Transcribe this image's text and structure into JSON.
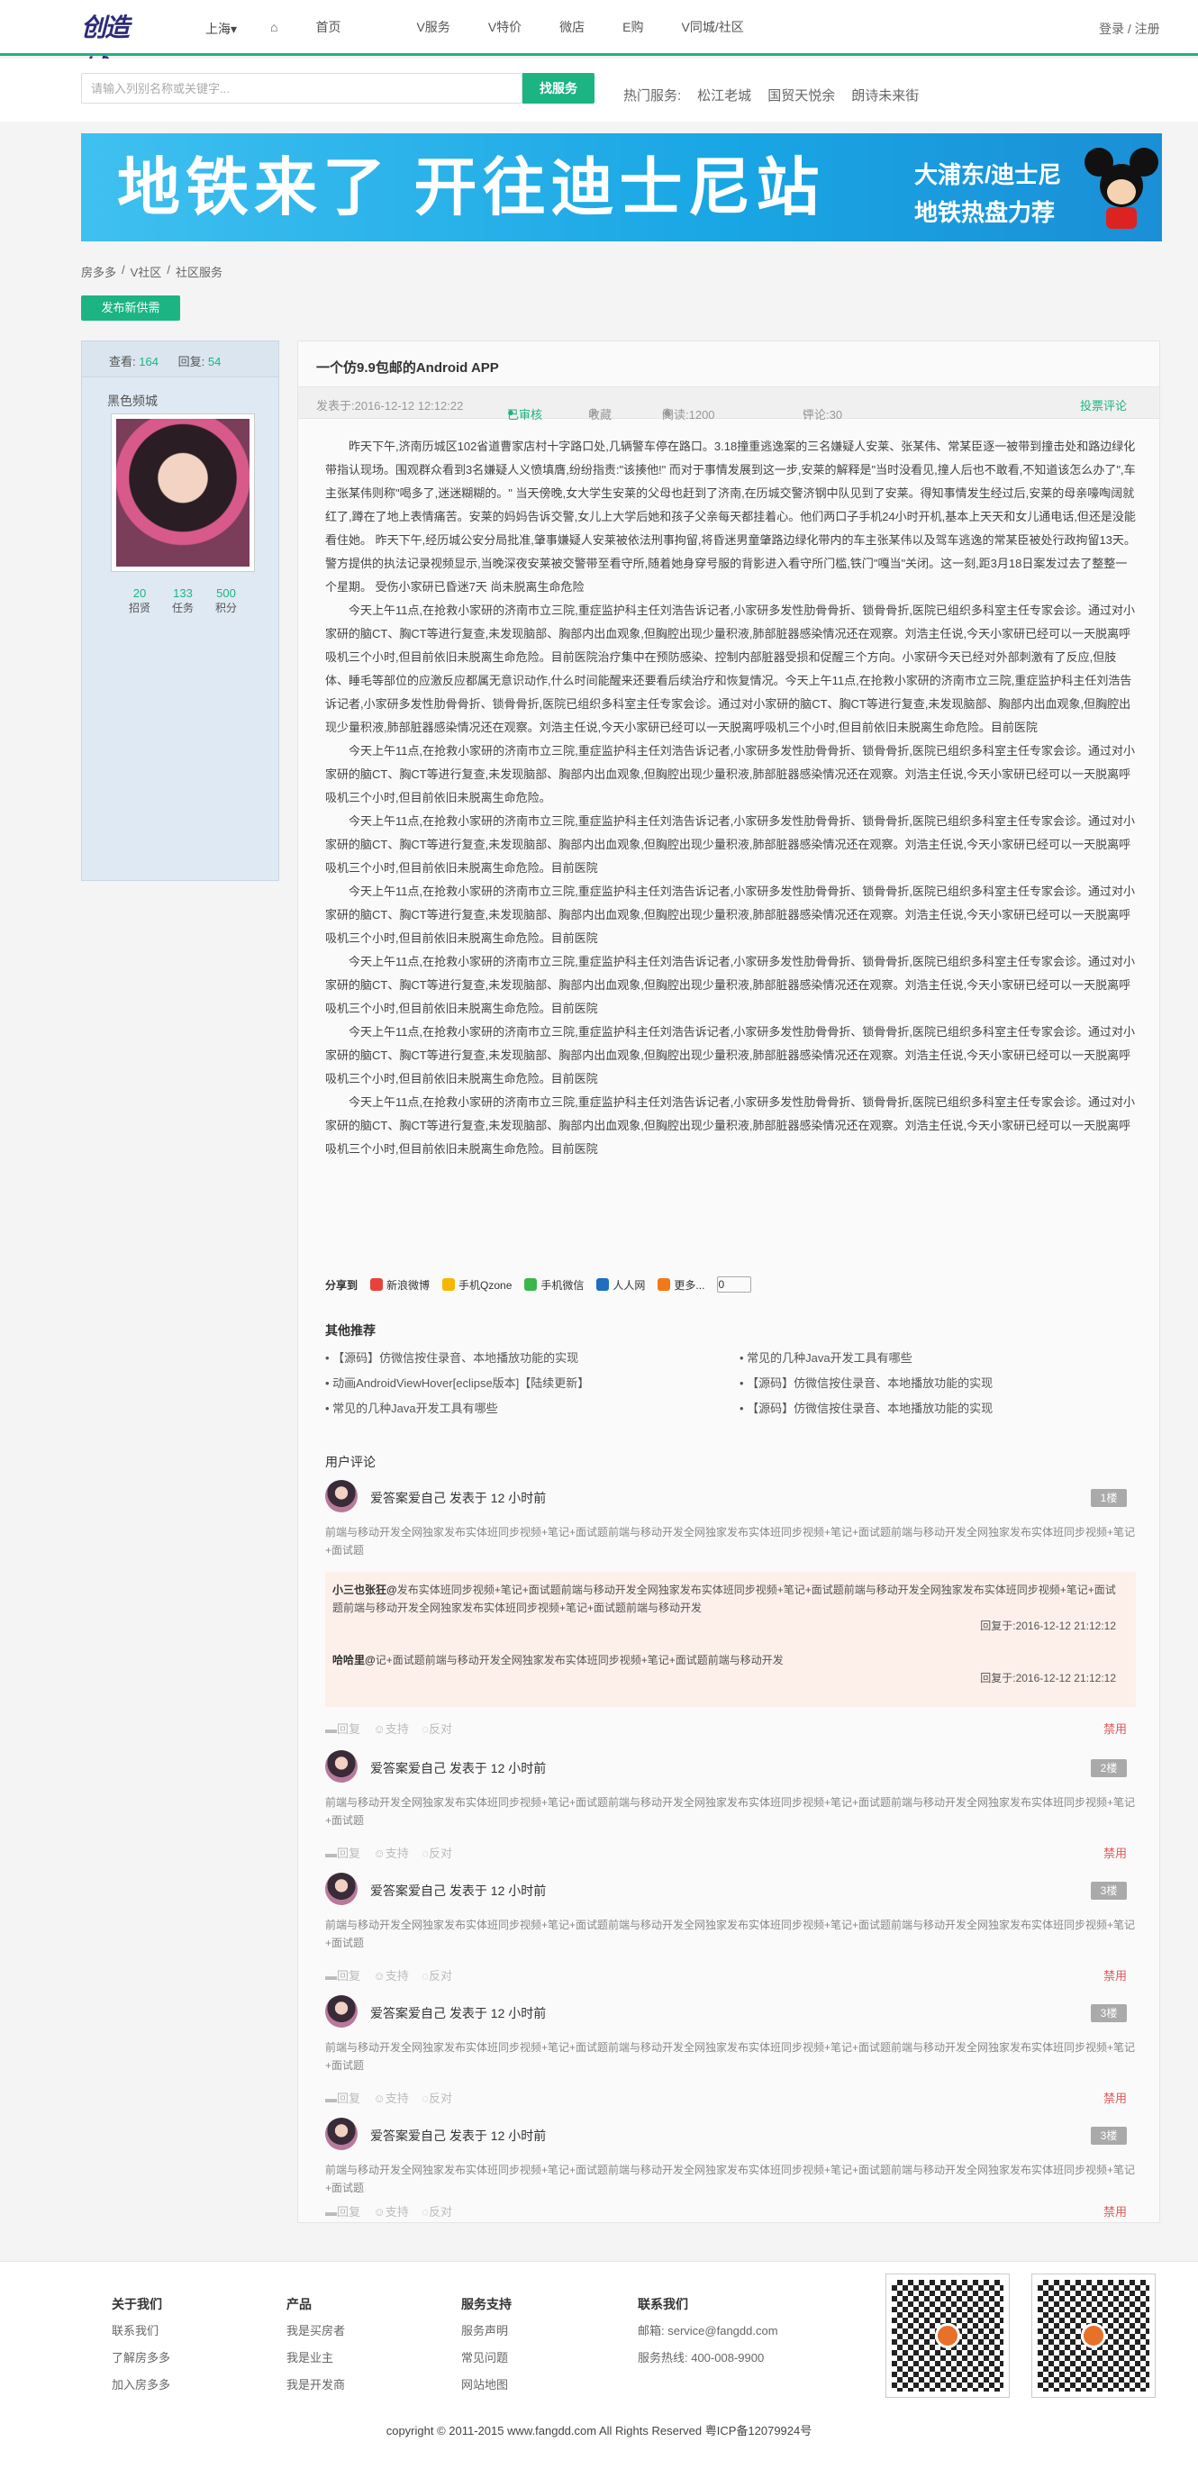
{
  "header": {
    "logo": "创造城",
    "city": "上海",
    "nav": [
      "首页",
      "V服务",
      "V特价",
      "微店",
      "E购",
      "V同城/社区"
    ],
    "login": "登录 / 注册"
  },
  "search": {
    "placeholder": "请输入列别名称或关键字...",
    "button": "找服务",
    "hot": [
      "热门服务:",
      "松江老城",
      "国贸天悦余",
      "朗诗未来街"
    ]
  },
  "banner": {
    "main": "地铁来了 开往迪士尼站",
    "side1": "大浦东/迪士尼",
    "side2": "地铁热盘力荐"
  },
  "breadcrumb": [
    "房多多",
    "/",
    "V社区",
    "/",
    "社区服务"
  ],
  "publish_label": "发布新供需",
  "sidebar": {
    "views_label": "查看:",
    "views": "164",
    "replies_label": "回复:",
    "replies": "54",
    "username": "黑色频城",
    "stats": [
      {
        "n": "20",
        "l": "招贤"
      },
      {
        "n": "133",
        "l": "任务"
      },
      {
        "n": "500",
        "l": "积分"
      }
    ]
  },
  "post": {
    "title": "一个仿9.9包邮的Android APP",
    "published": "发表于:2016-12-12 12:12:22",
    "status": "已审核",
    "collect": "收藏",
    "reads": "阅读:1200",
    "comments": "评论:30",
    "report": "投票评论",
    "paragraphs": [
      "昨天下午,济南历城区102省道曹家店村十字路口处,几辆警车停在路口。3.18撞重逃逸案的三名嫌疑人安莱、张某伟、常某臣逐一被带到撞击处和路边绿化带指认现场。围观群众看到3名嫌疑人义愤填膺,纷纷指责:\"该揍他!\" 而对于事情发展到这一步,安莱的解释是\"当时没看见,撞人后也不敢看,不知道该怎么办了\",车主张某伟则称\"喝多了,迷迷糊糊的。\"  当天傍晚,女大学生安莱的父母也赶到了济南,在历城交警济钢中队见到了安莱。得知事情发生经过后,安莱的母亲嚎啕阔就红了,蹲在了地上表情痛苦。安莱的妈妈告诉交警,女儿上大学后她和孩子父亲每天都挂着心。他们两口子手机24小时开机,基本上天天和女儿通电话,但还是没能看住她。  昨天下午,经历城公安分局批准,肇事嫌疑人安莱被依法刑事拘留,将昏迷男童肇路边绿化带内的车主张某伟以及驾车逃逸的常某臣被处行政拘留13天。警方提供的执法记录视频显示,当晚深夜安莱被交警带至看守所,随着她身穿号服的背影进入看守所门槛,铁门\"嘎当\"关闭。这一刻,距3月18日案发过去了整整一个星期。  受伤小家研已昏迷7天 尚未脱离生命危险",
      "今天上午11点,在抢救小家研的济南市立三院,重症监护科主任刘浩告诉记者,小家研多发性肋骨骨折、锁骨骨折,医院已组织多科室主任专家会诊。通过对小家研的脑CT、胸CT等进行复查,未发现脑部、胸部内出血观象,但胸腔出现少量积液,肺部脏器感染情况还在观察。刘浩主任说,今天小家研已经可以一天脱离呼吸机三个小时,但目前依旧未脱离生命危险。目前医院治疗集中在预防感染、控制内部脏器受损和促醒三个方向。小家研今天已经对外部刺激有了反应,但肢体、睡毛等部位的应激反应都属无意识动作,什么时间能醒来还要看后续治疗和恢复情况。今天上午11点,在抢救小家研的济南市立三院,重症监护科主任刘浩告诉记者,小家研多发性肋骨骨折、锁骨骨折,医院已组织多科室主任专家会诊。通过对小家研的脑CT、胸CT等进行复查,未发现脑部、胸部内出血观象,但胸腔出现少量积液,肺部脏器感染情况还在观察。刘浩主任说,今天小家研已经可以一天脱离呼吸机三个小时,但目前依旧未脱离生命危险。目前医院",
      "今天上午11点,在抢救小家研的济南市立三院,重症监护科主任刘浩告诉记者,小家研多发性肋骨骨折、锁骨骨折,医院已组织多科室主任专家会诊。通过对小家研的脑CT、胸CT等进行复查,未发现脑部、胸部内出血观象,但胸腔出现少量积液,肺部脏器感染情况还在观察。刘浩主任说,今天小家研已经可以一天脱离呼吸机三个小时,但目前依旧未脱离生命危险。",
      "今天上午11点,在抢救小家研的济南市立三院,重症监护科主任刘浩告诉记者,小家研多发性肋骨骨折、锁骨骨折,医院已组织多科室主任专家会诊。通过对小家研的脑CT、胸CT等进行复查,未发现脑部、胸部内出血观象,但胸腔出现少量积液,肺部脏器感染情况还在观察。刘浩主任说,今天小家研已经可以一天脱离呼吸机三个小时,但目前依旧未脱离生命危险。目前医院",
      "今天上午11点,在抢救小家研的济南市立三院,重症监护科主任刘浩告诉记者,小家研多发性肋骨骨折、锁骨骨折,医院已组织多科室主任专家会诊。通过对小家研的脑CT、胸CT等进行复查,未发现脑部、胸部内出血观象,但胸腔出现少量积液,肺部脏器感染情况还在观察。刘浩主任说,今天小家研已经可以一天脱离呼吸机三个小时,但目前依旧未脱离生命危险。目前医院",
      "今天上午11点,在抢救小家研的济南市立三院,重症监护科主任刘浩告诉记者,小家研多发性肋骨骨折、锁骨骨折,医院已组织多科室主任专家会诊。通过对小家研的脑CT、胸CT等进行复查,未发现脑部、胸部内出血观象,但胸腔出现少量积液,肺部脏器感染情况还在观察。刘浩主任说,今天小家研已经可以一天脱离呼吸机三个小时,但目前依旧未脱离生命危险。目前医院",
      "今天上午11点,在抢救小家研的济南市立三院,重症监护科主任刘浩告诉记者,小家研多发性肋骨骨折、锁骨骨折,医院已组织多科室主任专家会诊。通过对小家研的脑CT、胸CT等进行复查,未发现脑部、胸部内出血观象,但胸腔出现少量积液,肺部脏器感染情况还在观察。刘浩主任说,今天小家研已经可以一天脱离呼吸机三个小时,但目前依旧未脱离生命危险。目前医院",
      "今天上午11点,在抢救小家研的济南市立三院,重症监护科主任刘浩告诉记者,小家研多发性肋骨骨折、锁骨骨折,医院已组织多科室主任专家会诊。通过对小家研的脑CT、胸CT等进行复查,未发现脑部、胸部内出血观象,但胸腔出现少量积液,肺部脏器感染情况还在观察。刘浩主任说,今天小家研已经可以一天脱离呼吸机三个小时,但目前依旧未脱离生命危险。目前医院"
    ]
  },
  "share": {
    "label": "分享到",
    "items": [
      "新浪微博",
      "手机Qzone",
      "手机微信",
      "人人网",
      "更多..."
    ],
    "count": "0"
  },
  "other": {
    "title": "其他推荐",
    "items": [
      "【源码】仿微信按住录音、本地播放功能的实现",
      "常见的几种Java开发工具有哪些",
      "动画AndroidViewHover[eclipse版本]【陆续更新】",
      "【源码】仿微信按住录音、本地播放功能的实现",
      "常见的几种Java开发工具有哪些",
      "【源码】仿微信按住录音、本地播放功能的实现"
    ]
  },
  "comments": {
    "title": "用户评论",
    "who": "爱答案爱自己  发表于 12 小时前",
    "text": "前端与移动开发全网独家发布实体班同步视频+笔记+面试题前端与移动开发全网独家发布实体班同步视频+笔记+面试题前端与移动开发全网独家发布实体班同步视频+笔记+面试题",
    "floors": [
      "1楼",
      "2楼",
      "3楼",
      "3楼",
      "3楼"
    ],
    "reply_label": "回复",
    "support_label": "支持",
    "oppose_label": "反对",
    "ban_label": "禁用",
    "replies": [
      {
        "user": "小三也张狂@",
        "text": "发布实体班同步视频+笔记+面试题前端与移动开发全网独家发布实体班同步视频+笔记+面试题前端与移动开发全网独家发布实体班同步视频+笔记+面试题前端与移动开发全网独家发布实体班同步视频+笔记+面试题前端与移动开发",
        "time": "回复于:2016-12-12 21:12:12"
      },
      {
        "user": "哈哈里@",
        "text": "记+面试题前端与移动开发全网独家发布实体班同步视频+笔记+面试题前端与移动开发",
        "time": "回复于:2016-12-12 21:12:12"
      }
    ]
  },
  "footer": {
    "cols": [
      {
        "h": "关于我们",
        "items": [
          "联系我们",
          "了解房多多",
          "加入房多多"
        ]
      },
      {
        "h": "产品",
        "items": [
          "我是买房者",
          "我是业主",
          "我是开发商"
        ]
      },
      {
        "h": "服务支持",
        "items": [
          "服务声明",
          "常见问题",
          "网站地图"
        ]
      },
      {
        "h": "联系我们",
        "items": [
          "邮箱: service@fangdd.com",
          "服务热线: 400-008-9900"
        ]
      }
    ],
    "copyright": "copyright © 2011-2015 www.fangdd.com All Rights Reserved 粤ICP备12079924号"
  }
}
